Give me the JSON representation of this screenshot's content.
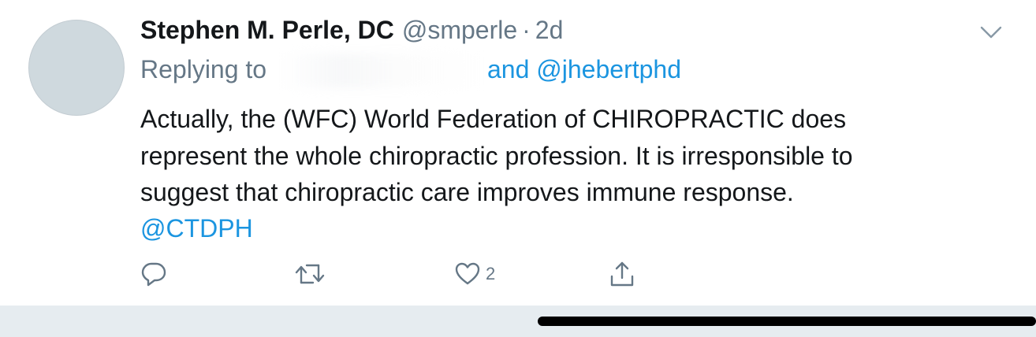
{
  "tweet": {
    "author_name": "Stephen M. Perle, DC",
    "handle": "@smperle",
    "separator": "·",
    "time": "2d",
    "replying_prefix": "Replying to",
    "reply_handles": "and @jhebertphd",
    "text": "Actually, the (WFC) World Federation of CHIROPRACTIC does\nrepresent the whole chiropractic profession.  It is irresponsible to\nsuggest that chiropractic care improves immune response.",
    "mention": "@CTDPH"
  },
  "actions": {
    "reply_icon": "reply-icon",
    "retweet_icon": "retweet-icon",
    "like_icon": "heart-icon",
    "like_count": "2",
    "share_icon": "share-icon",
    "menu_icon": "chevron-down-icon"
  },
  "colors": {
    "link": "#1b95e0",
    "secondary_text": "#657786",
    "primary_text": "#14171a",
    "avatar_placeholder": "#cfd9de",
    "bottom_bar": "#e6ecf0"
  }
}
